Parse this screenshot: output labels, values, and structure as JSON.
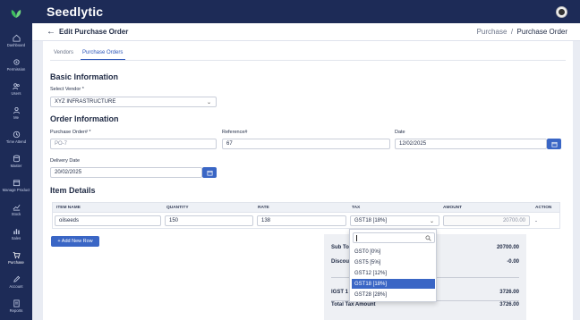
{
  "app": {
    "brand": "Seedlytic"
  },
  "sidebar": {
    "items": [
      {
        "label": "Dashboard",
        "icon": "home-icon"
      },
      {
        "label": "Permission",
        "icon": "gear-icon"
      },
      {
        "label": "Users",
        "icon": "users-icon"
      },
      {
        "label": "Me",
        "icon": "user-icon"
      },
      {
        "label": "Time Attend",
        "icon": "clock-icon"
      },
      {
        "label": "Master",
        "icon": "database-icon"
      },
      {
        "label": "Manage Product",
        "icon": "box-icon"
      },
      {
        "label": "Stock",
        "icon": "trend-icon"
      },
      {
        "label": "Sales",
        "icon": "bar-chart-icon"
      },
      {
        "label": "Purchase",
        "icon": "cart-icon"
      },
      {
        "label": "Account",
        "icon": "pen-icon"
      },
      {
        "label": "Reports",
        "icon": "report-icon"
      }
    ]
  },
  "header": {
    "title": "Edit Purchase Order",
    "breadcrumb_parent": "Purchase",
    "breadcrumb_sep": "/",
    "breadcrumb_current": "Purchase Order"
  },
  "tabs": {
    "vendors": "Vendors",
    "purchase_orders": "Purchase Orders"
  },
  "basic": {
    "title": "Basic Information",
    "vendor_label": "Select Vendor *",
    "vendor_value": "XYZ INFRASTRUCTURE"
  },
  "order": {
    "title": "Order Information",
    "po_label": "Purchase Order# *",
    "po_value": "PO-7",
    "ref_label": "Reference#",
    "ref_value": "67",
    "date_label": "Date",
    "date_value": "12/02/2025",
    "delivery_label": "Delivery Date",
    "delivery_value": "20/02/2025"
  },
  "items": {
    "title": "Item Details",
    "headers": {
      "name": "ITEM NAME",
      "quantity": "QUANTITY",
      "rate": "RATE",
      "tax": "TAX",
      "amount": "AMOUNT",
      "action": "ACTION"
    },
    "row": {
      "name": "oilseeds",
      "quantity": "150",
      "rate": "138",
      "tax": "GST18 [18%]",
      "amount": "20700.00",
      "action": "-"
    },
    "add_button": "+ Add New Row"
  },
  "summary": {
    "subtotal_label": "Sub To",
    "subtotal_value": "20700.00",
    "discount_label": "Discou",
    "discount_value": "-0.00",
    "igst_label": "IGST 1",
    "igst_value": "3726.00",
    "total_tax_label": "Total Tax Amount",
    "total_tax_value": "3726.00"
  },
  "tax_dropdown": {
    "options": [
      "GST0 [0%]",
      "GST5 [5%]",
      "GST12 [12%]",
      "GST18 [18%]",
      "GST28 [28%]"
    ],
    "selected": "GST18 [18%]"
  },
  "colors": {
    "sidebar": "#1d2b57",
    "accent": "#3a66c5"
  }
}
